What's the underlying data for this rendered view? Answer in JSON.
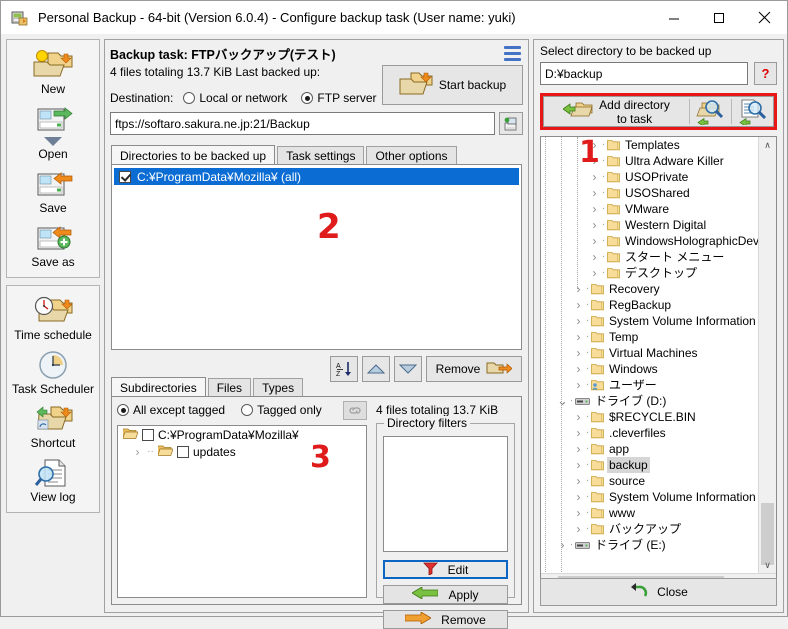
{
  "window": {
    "title": "Personal Backup - 64-bit (Version 6.0.4) - Configure backup task (User name: yuki)",
    "app_icon": "app-icon",
    "minimize": "–",
    "maximize": "☐",
    "close": "✕"
  },
  "sidebar": {
    "group1": [
      {
        "label": "New",
        "icon": "new-task-icon"
      },
      {
        "label": "Open",
        "icon": "open-task-icon"
      },
      {
        "label": "Save",
        "icon": "save-task-icon"
      },
      {
        "label": "Save as",
        "icon": "save-as-task-icon"
      }
    ],
    "group2": [
      {
        "label": "Time schedule",
        "icon": "time-schedule-icon"
      },
      {
        "label": "Task Scheduler",
        "icon": "task-scheduler-icon"
      },
      {
        "label": "Shortcut",
        "icon": "shortcut-icon"
      },
      {
        "label": "View log",
        "icon": "view-log-icon"
      }
    ]
  },
  "main": {
    "task_title": "Backup task: FTPバックアップ(テスト)",
    "files_summary": "4 files totaling 13.7 KiB   Last backed up:",
    "destination_label": "Destination:",
    "dest_local": "Local or network",
    "dest_ftp": "FTP server",
    "dest_selected": "ftp",
    "start_backup": "Start backup",
    "url_value": "ftps://softaro.sakura.ne.jp:21/Backup",
    "tabs": [
      {
        "label": "Directories to be backed up",
        "active": true
      },
      {
        "label": "Task settings",
        "active": false
      },
      {
        "label": "Other options",
        "active": false
      }
    ],
    "directory_rows": [
      {
        "label": "C:¥ProgramData¥Mozilla¥  (all)",
        "checked": true,
        "selected": true
      }
    ],
    "annotation_2": "2",
    "toolbar": {
      "sort_icon": "sort-az-icon",
      "move_up_icon": "move-up-icon",
      "move_down_icon": "move-down-icon",
      "remove_label": "Remove",
      "remove_icon": "remove-folder-icon"
    },
    "subtabs": [
      {
        "label": "Subdirectories",
        "active": true
      },
      {
        "label": "Files",
        "active": false
      },
      {
        "label": "Types",
        "active": false
      }
    ],
    "radio_all_except": "All except tagged",
    "radio_tagged_only": "Tagged only",
    "radio_selected": "all_except",
    "link_icon": "link-icon",
    "subtree": [
      {
        "label": "C:¥ProgramData¥Mozilla¥",
        "depth": 0,
        "checked": false,
        "twisty": ""
      },
      {
        "label": "updates",
        "depth": 1,
        "checked": false,
        "twisty": "›"
      }
    ],
    "annotation_3": "3",
    "files_total": "4 files totaling 13.7 KiB",
    "filters_group_title": "Directory filters",
    "filter_items": [],
    "btn_edit": "Edit",
    "btn_apply": "Apply",
    "btn_remove": "Remove"
  },
  "right": {
    "label": "Select directory to be backed up",
    "path_value": "D:¥backup",
    "help_label": "?",
    "add_directory": "Add directory\nto task",
    "add_directory_line1": "Add directory",
    "add_directory_line2": "to task",
    "icon_btn_1": "browse-folder-icon",
    "icon_btn_2": "browse-file-icon",
    "annotation_1": "1",
    "tree": [
      {
        "label": "Templates",
        "depth": 3,
        "twisty": "›",
        "icon": "folder",
        "selected": false
      },
      {
        "label": "Ultra Adware Killer",
        "depth": 3,
        "twisty": "›",
        "icon": "folder",
        "selected": false
      },
      {
        "label": "USOPrivate",
        "depth": 3,
        "twisty": "›",
        "icon": "folder",
        "selected": false
      },
      {
        "label": "USOShared",
        "depth": 3,
        "twisty": "›",
        "icon": "folder",
        "selected": false
      },
      {
        "label": "VMware",
        "depth": 3,
        "twisty": "›",
        "icon": "folder",
        "selected": false
      },
      {
        "label": "Western Digital",
        "depth": 3,
        "twisty": "›",
        "icon": "folder",
        "selected": false
      },
      {
        "label": "WindowsHolographicDev",
        "depth": 3,
        "twisty": "›",
        "icon": "folder",
        "selected": false
      },
      {
        "label": "スタート メニュー",
        "depth": 3,
        "twisty": "›",
        "icon": "folder",
        "selected": false
      },
      {
        "label": "デスクトップ",
        "depth": 3,
        "twisty": "›",
        "icon": "folder",
        "selected": false
      },
      {
        "label": "Recovery",
        "depth": 2,
        "twisty": "›",
        "icon": "folder",
        "selected": false
      },
      {
        "label": "RegBackup",
        "depth": 2,
        "twisty": "›",
        "icon": "folder",
        "selected": false
      },
      {
        "label": "System Volume Information",
        "depth": 2,
        "twisty": "›",
        "icon": "folder",
        "selected": false
      },
      {
        "label": "Temp",
        "depth": 2,
        "twisty": "›",
        "icon": "folder",
        "selected": false
      },
      {
        "label": "Virtual Machines",
        "depth": 2,
        "twisty": "›",
        "icon": "folder",
        "selected": false
      },
      {
        "label": "Windows",
        "depth": 2,
        "twisty": "›",
        "icon": "folder",
        "selected": false
      },
      {
        "label": "ユーザー",
        "depth": 2,
        "twisty": "›",
        "icon": "users-folder",
        "selected": false
      },
      {
        "label": "ドライブ (D:)",
        "depth": 1,
        "twisty": "⌄",
        "icon": "drive",
        "selected": false
      },
      {
        "label": "$RECYCLE.BIN",
        "depth": 2,
        "twisty": "›",
        "icon": "folder",
        "selected": false
      },
      {
        "label": ".cleverfiles",
        "depth": 2,
        "twisty": "›",
        "icon": "folder",
        "selected": false
      },
      {
        "label": "app",
        "depth": 2,
        "twisty": "›",
        "icon": "folder",
        "selected": false
      },
      {
        "label": "backup",
        "depth": 2,
        "twisty": "›",
        "icon": "folder",
        "selected": true
      },
      {
        "label": "source",
        "depth": 2,
        "twisty": "›",
        "icon": "folder",
        "selected": false
      },
      {
        "label": "System Volume Information",
        "depth": 2,
        "twisty": "›",
        "icon": "folder",
        "selected": false
      },
      {
        "label": "www",
        "depth": 2,
        "twisty": "›",
        "icon": "folder",
        "selected": false
      },
      {
        "label": "バックアップ",
        "depth": 2,
        "twisty": "›",
        "icon": "folder",
        "selected": false
      },
      {
        "label": "ドライブ (E:)",
        "depth": 1,
        "twisty": "›",
        "icon": "drive",
        "selected": false
      }
    ],
    "scroll_up": "∧",
    "scroll_down": "∨",
    "scroll_left": "‹",
    "scroll_right": "›",
    "close_label": "Close",
    "close_icon": "close-arrow-icon"
  },
  "colors": {
    "accent_blue": "#4472c4",
    "selection_blue": "#0b6cd4",
    "annotation_red": "#e01b1b",
    "folder_yellow": "#ffd966",
    "window_bg": "#f0f0f0"
  }
}
